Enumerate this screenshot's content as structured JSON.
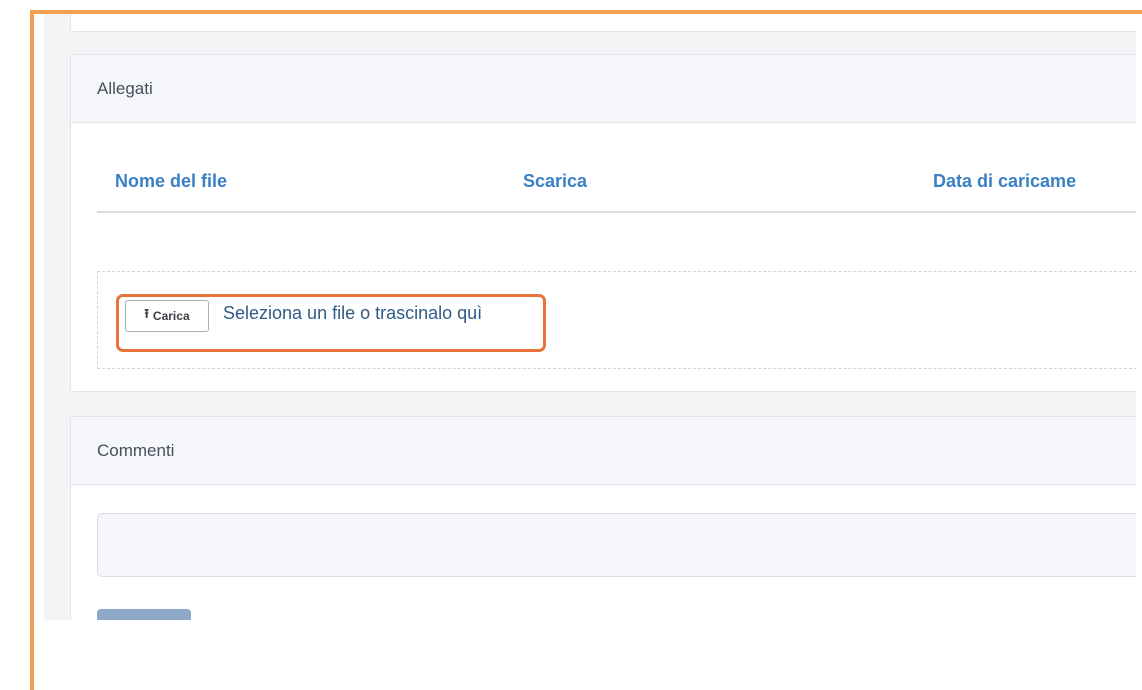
{
  "attachments": {
    "title": "Allegati",
    "columns": [
      "Nome del file",
      "Scarica",
      "Data di caricame"
    ],
    "upload": {
      "button_icon": "upload-icon",
      "button_label": "Carica",
      "drop_text": "Seleziona un file o trascinalo quì"
    },
    "highlight_color": "#e8733a"
  },
  "comments": {
    "title": "Commenti",
    "input_value": "",
    "submit_color": "#8ea8c8"
  },
  "frame_color": "#f0a050",
  "accent_color": "#3a80c4"
}
